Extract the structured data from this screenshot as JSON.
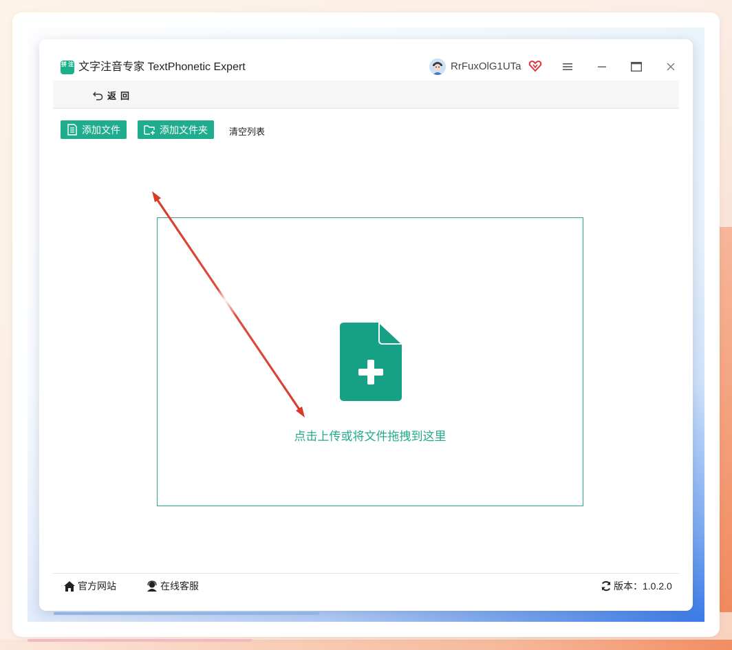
{
  "window": {
    "app_title": "文字注音专家 TextPhonetic Expert",
    "logo_text": "拼 注",
    "username": "RrFuxOlG1UTa",
    "icons": {
      "avatar": "avatar-icon",
      "vip": "vip-heart-icon",
      "menu": "hamburger-menu-icon",
      "minimize": "minimize-icon",
      "maximize": "maximize-icon",
      "close": "close-icon"
    }
  },
  "nav": {
    "back_label": "返回",
    "back_icon": "undo-arrow-icon"
  },
  "toolbar": {
    "add_file_label": "添加文件",
    "add_folder_label": "添加文件夹",
    "clear_list_label": "清空列表"
  },
  "dropzone": {
    "text": "点击上传或将文件拖拽到这里",
    "icon": "file-add-icon"
  },
  "footer": {
    "website_label": "官方网站",
    "support_label": "在线客服",
    "version_label": "版本：1.0.2.0"
  },
  "colors": {
    "accent": "#20ad8e",
    "annotation_arrow": "#d9392b"
  }
}
